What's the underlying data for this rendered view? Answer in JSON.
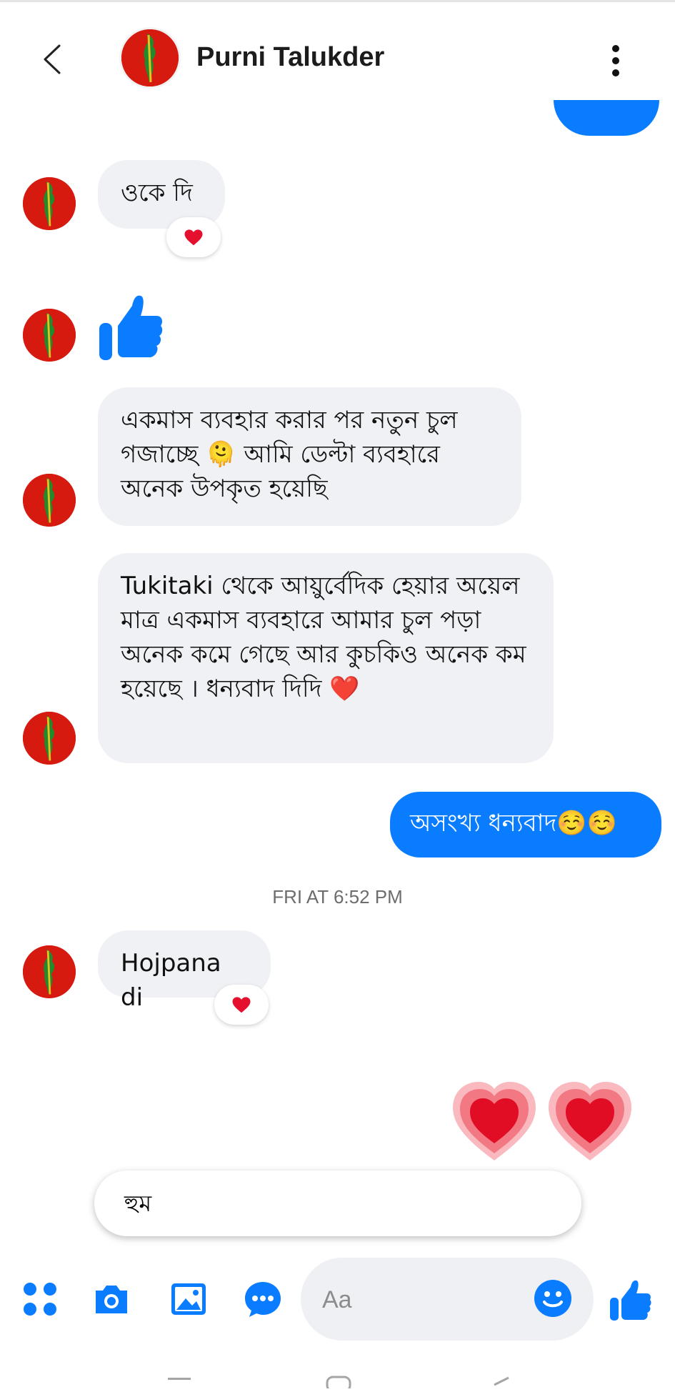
{
  "header": {
    "title": "Purni Talukder"
  },
  "messages": [
    {
      "text": "ওকে দি"
    },
    {
      "text": "একমাস ব্যবহার করার পর নতুন চুল গজাচ্ছে 🫠 আমি ডেল্টা ব্যবহারে অনেক উপকৃত হয়েছি"
    },
    {
      "text": "Tukitaki থেকে আয়ুর্বেদিক হেয়ার অয়েল     মাত্র একমাস ব্যবহারে আমার চুল পড়া অনেক কমে গেছে আর কুচকিও অনেক কম হয়েছে । ধন্যবাদ দিদি ❤️"
    },
    {
      "text": "অসংখ্য ধন্যবাদ☺️☺️"
    },
    {
      "text": "Hojpana di"
    }
  ],
  "timestamp": "FRI AT 6:52 PM",
  "quick_reply": "হুম",
  "composer": {
    "placeholder": "Aa"
  },
  "colors": {
    "accent": "#0a7cff",
    "bubble_gray": "#f0f1f4",
    "heart_red": "#e5102d"
  }
}
